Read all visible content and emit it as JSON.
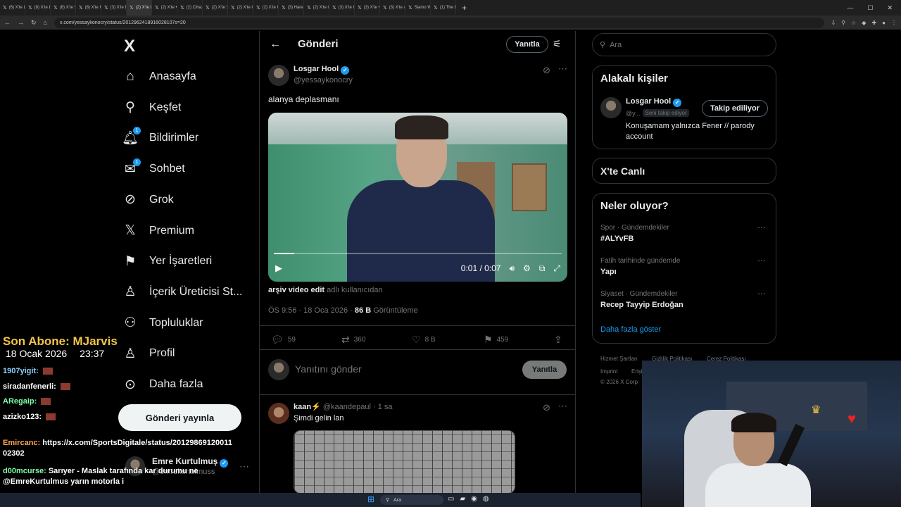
{
  "browser": {
    "tabs": [
      {
        "label": "(6) X'te L",
        "active": false
      },
      {
        "label": "(8) X'te Lo",
        "active": false
      },
      {
        "label": "(8) X'te Sp",
        "active": false
      },
      {
        "label": "(8) X'te K",
        "active": false
      },
      {
        "label": "(3) X'te Di",
        "active": false
      },
      {
        "label": "(2) X'te Lo",
        "active": true
      },
      {
        "label": "(2) X'te •",
        "active": false
      },
      {
        "label": "(2) Cihazın",
        "active": false
      },
      {
        "label": "(2) X'te Sp",
        "active": false
      },
      {
        "label": "(2) X'te Cy",
        "active": false
      },
      {
        "label": "(2) X'te In",
        "active": false
      },
      {
        "label": "(3) Hareke",
        "active": false
      },
      {
        "label": "(2) X'te O",
        "active": false
      },
      {
        "label": "(3) X'te Ib",
        "active": false
      },
      {
        "label": "(3) X'te •",
        "active": false
      },
      {
        "label": "(3) X'te ars",
        "active": false
      },
      {
        "label": "Siamo Wi",
        "active": false
      },
      {
        "label": "(1) The B",
        "active": false
      }
    ],
    "url": "x.com/yessaykonocry/status/2012962418916028107s=20"
  },
  "sidebar": {
    "logo": "X",
    "items": [
      {
        "label": "Anasayfa",
        "icon": "home-icon",
        "glyph": "⌂",
        "badge": ""
      },
      {
        "label": "Keşfet",
        "icon": "search-icon",
        "glyph": "⚲",
        "badge": ""
      },
      {
        "label": "Bildirimler",
        "icon": "bell-icon",
        "glyph": "🔔︎",
        "badge": "1"
      },
      {
        "label": "Sohbet",
        "icon": "mail-icon",
        "glyph": "✉",
        "badge": "1"
      },
      {
        "label": "Grok",
        "icon": "grok-icon",
        "glyph": "⊘",
        "badge": ""
      },
      {
        "label": "Premium",
        "icon": "x-premium-icon",
        "glyph": "𝕏",
        "badge": ""
      },
      {
        "label": "Yer İşaretleri",
        "icon": "bookmark-icon",
        "glyph": "⚑",
        "badge": ""
      },
      {
        "label": "İçerik Üreticisi St...",
        "icon": "creator-icon",
        "glyph": "♙",
        "badge": ""
      },
      {
        "label": "Topluluklar",
        "icon": "communities-icon",
        "glyph": "⚇",
        "badge": ""
      },
      {
        "label": "Profil",
        "icon": "profile-icon",
        "glyph": "♙",
        "badge": ""
      },
      {
        "label": "Daha fazla",
        "icon": "more-circle-icon",
        "glyph": "⊙",
        "badge": ""
      }
    ],
    "post_button": "Gönderi yayınla",
    "account": {
      "name": "Emre Kurtulmuş",
      "handle": "@emrekurtulmuss"
    }
  },
  "overlay": {
    "sub_label": "Son Abone: MJarvis",
    "date": "18 Ocak 2026",
    "time": "23:37",
    "chat": [
      {
        "user": "1907yigit:",
        "text": ""
      },
      {
        "user": "siradanfenerli:",
        "text": ""
      },
      {
        "user": "ARegaip:",
        "text": ""
      },
      {
        "user": "azizko123:",
        "text": ""
      },
      {
        "user": "Emircanc:",
        "text": "https://x.com/SportsDigitale/status/20129869120011"
      },
      {
        "user": "",
        "text": "02302"
      },
      {
        "user": "d00mcurse:",
        "text": "Sarıyer - Maslak tarafında kar durumu ne"
      },
      {
        "user": "",
        "text": "@EmreKurtulmus yarın motorla i"
      }
    ]
  },
  "center": {
    "header_title": "Gönderi",
    "reply_button": "Yanıtla",
    "post": {
      "name": "Losgar Hool",
      "handle": "@yessaykonocry",
      "text": "alanya deplasmanı",
      "video_time": "0:01 / 0:07",
      "video_progress": 0.07,
      "caption_bold": "arşiv video edit",
      "caption_rest": " adlı kullanıcıdan",
      "timestamp": "ÖS 9:56 · 18 Oca 2026 · ",
      "views_count": "86 B",
      "views_label": " Görüntüleme",
      "stats": {
        "replies": "59",
        "reposts": "360",
        "likes": "8 B",
        "bookmarks": "459"
      }
    },
    "reply_box": {
      "placeholder": "Yanıtını gönder",
      "button": "Yanıtla"
    },
    "reply": {
      "name": "kaan⚡",
      "handle": "@kaandepaul",
      "time": "· 1 sa",
      "text": "Şimdi gelin lan"
    }
  },
  "right": {
    "search_placeholder": "Ara",
    "related": {
      "title": "Alakalı kişiler",
      "name": "Losgar Hool",
      "handle": "@y...",
      "follows_you": "Seni takip ediyor",
      "follow_button": "Takip ediliyor",
      "bio": "Konuşamam yalnızca Fener // parody account"
    },
    "live_title": "X'te Canlı",
    "trends": {
      "title": "Neler oluyor?",
      "items": [
        {
          "meta": "Spor · Gündemdekiler",
          "title": "#ALYvFB"
        },
        {
          "meta": "Fatih tarihinde gündemde",
          "title": "Yapı"
        },
        {
          "meta": "Siyaset · Gündemdekiler",
          "title": "Recep Tayyip Erdoğan"
        }
      ],
      "show_more": "Daha fazla göster"
    },
    "footer": [
      "Hizmet Şartları",
      "Gizlilik Politikası",
      "Çerez Politikası",
      "Imprint",
      "Erişi",
      "© 2026 X Corp"
    ]
  },
  "taskbar": {
    "search": "Ara"
  },
  "colors": {
    "accent": "#1d9bf0",
    "background": "#000000",
    "border": "#2f3336",
    "muted": "#71767b"
  }
}
